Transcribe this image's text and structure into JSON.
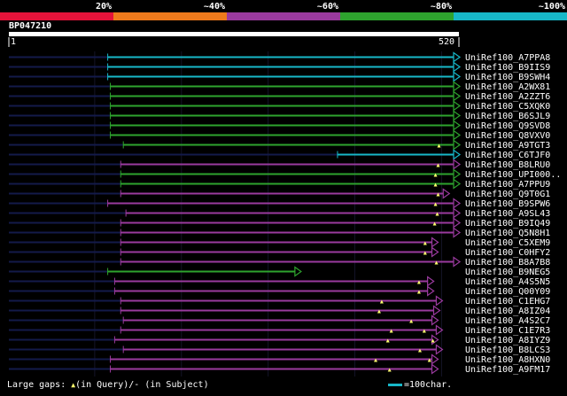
{
  "query": {
    "id": "BP047210",
    "start_label": "1",
    "end_label": "520",
    "length": 520
  },
  "scale": {
    "labels": [
      "20%",
      "~40%",
      "~60%",
      "~80%",
      "~100%"
    ],
    "colors": [
      "#e4133a",
      "#ee7a1c",
      "#9a3a9e",
      "#2ea32e",
      "#17b7c8"
    ]
  },
  "footer": {
    "left_prefix": "Large gaps: ",
    "left_marker": "▲",
    "left_suffix": "(in Query)/- (in Subject)",
    "right": "=100char."
  },
  "chart_data": {
    "type": "alignment-overview",
    "x_unit": "residue position in query",
    "xlim": [
      1,
      520
    ],
    "colors": {
      "identity_100": "#17b7c8",
      "identity_80": "#2ea32e",
      "identity_60": "#9a3a9e"
    },
    "hits": [
      {
        "name": "UniRef100_A7PPA8",
        "start": 115,
        "end": 520,
        "identity_class": "~100%",
        "gaps": []
      },
      {
        "name": "UniRef100_B9IIS9",
        "start": 115,
        "end": 520,
        "identity_class": "~100%",
        "gaps": []
      },
      {
        "name": "UniRef100_B9SWH4",
        "start": 115,
        "end": 520,
        "identity_class": "~100%",
        "gaps": []
      },
      {
        "name": "UniRef100_A2WX81",
        "start": 118,
        "end": 520,
        "identity_class": "~80%",
        "gaps": []
      },
      {
        "name": "UniRef100_A2ZZT6",
        "start": 118,
        "end": 520,
        "identity_class": "~80%",
        "gaps": []
      },
      {
        "name": "UniRef100_C5XQK0",
        "start": 118,
        "end": 520,
        "identity_class": "~80%",
        "gaps": []
      },
      {
        "name": "UniRef100_B6SJL9",
        "start": 118,
        "end": 520,
        "identity_class": "~80%",
        "gaps": []
      },
      {
        "name": "UniRef100_Q9SVD8",
        "start": 118,
        "end": 520,
        "identity_class": "~80%",
        "gaps": []
      },
      {
        "name": "UniRef100_Q8VXV0",
        "start": 118,
        "end": 520,
        "identity_class": "~80%",
        "gaps": []
      },
      {
        "name": "UniRef100_A9TGT3",
        "start": 133,
        "end": 520,
        "identity_class": "~80%",
        "gaps": [
          497
        ]
      },
      {
        "name": "UniRef100_C6TJF0",
        "start": 380,
        "end": 520,
        "identity_class": "~100%",
        "gaps": []
      },
      {
        "name": "UniRef100_B8LRU0",
        "start": 130,
        "end": 520,
        "identity_class": "~60%",
        "gaps": [
          496
        ]
      },
      {
        "name": "UniRef100_UPI000..",
        "start": 130,
        "end": 520,
        "identity_class": "~80%",
        "gaps": [
          493
        ]
      },
      {
        "name": "UniRef100_A7PPU9",
        "start": 130,
        "end": 520,
        "identity_class": "~80%",
        "gaps": [
          493
        ]
      },
      {
        "name": "UniRef100_Q9T0G1",
        "start": 130,
        "end": 508,
        "identity_class": "~60%",
        "gaps": [
          496
        ]
      },
      {
        "name": "UniRef100_B9SPW6",
        "start": 115,
        "end": 520,
        "identity_class": "~60%",
        "gaps": [
          493
        ]
      },
      {
        "name": "UniRef100_A9SL43",
        "start": 136,
        "end": 520,
        "identity_class": "~60%",
        "gaps": [
          495
        ]
      },
      {
        "name": "UniRef100_B9IQ49",
        "start": 130,
        "end": 520,
        "identity_class": "~60%",
        "gaps": [
          492
        ]
      },
      {
        "name": "UniRef100_Q5N8H1",
        "start": 130,
        "end": 520,
        "identity_class": "~60%",
        "gaps": []
      },
      {
        "name": "UniRef100_C5XEM9",
        "start": 130,
        "end": 495,
        "identity_class": "~60%",
        "gaps": [
          481
        ]
      },
      {
        "name": "UniRef100_C0HFY2",
        "start": 130,
        "end": 495,
        "identity_class": "~60%",
        "gaps": [
          481
        ]
      },
      {
        "name": "UniRef100_B8A7B8",
        "start": 130,
        "end": 520,
        "identity_class": "~60%",
        "gaps": [
          494
        ]
      },
      {
        "name": "UniRef100_B9NEG5",
        "start": 115,
        "end": 337,
        "identity_class": "~80%",
        "gaps": []
      },
      {
        "name": "UniRef100_A4S5N5",
        "start": 123,
        "end": 490,
        "identity_class": "~60%",
        "gaps": [
          474
        ]
      },
      {
        "name": "UniRef100_Q00Y09",
        "start": 123,
        "end": 490,
        "identity_class": "~60%",
        "gaps": [
          474
        ]
      },
      {
        "name": "UniRef100_C1EHG7",
        "start": 130,
        "end": 500,
        "identity_class": "~60%",
        "gaps": [
          431
        ]
      },
      {
        "name": "UniRef100_A8IZ04",
        "start": 130,
        "end": 497,
        "identity_class": "~60%",
        "gaps": [
          428
        ]
      },
      {
        "name": "UniRef100_A4S2C7",
        "start": 133,
        "end": 495,
        "identity_class": "~60%",
        "gaps": [
          465
        ]
      },
      {
        "name": "UniRef100_C1E7R3",
        "start": 130,
        "end": 500,
        "identity_class": "~60%",
        "gaps": [
          442,
          480
        ]
      },
      {
        "name": "UniRef100_A8IYZ9",
        "start": 123,
        "end": 495,
        "identity_class": "~60%",
        "gaps": [
          438,
          490
        ]
      },
      {
        "name": "UniRef100_B8LCS3",
        "start": 133,
        "end": 500,
        "identity_class": "~60%",
        "gaps": [
          475
        ]
      },
      {
        "name": "UniRef100_A8HXN0",
        "start": 118,
        "end": 495,
        "identity_class": "~60%",
        "gaps": [
          424,
          486
        ]
      },
      {
        "name": "UniRef100_A9FM17",
        "start": 118,
        "end": 495,
        "identity_class": "~60%",
        "gaps": [
          440
        ]
      }
    ]
  }
}
